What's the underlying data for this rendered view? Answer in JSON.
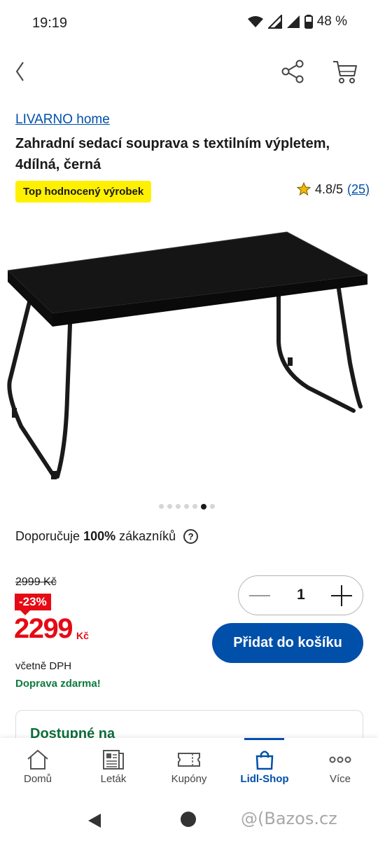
{
  "status_bar": {
    "time": "19:19",
    "battery": "48 %"
  },
  "header": {
    "back_icon": "chevron-left-icon",
    "share_icon": "share-icon",
    "cart_icon": "cart-icon"
  },
  "product": {
    "brand": "LIVARNO home",
    "title": "Zahradní sedací souprava s textilním výpletem, 4dílná, černá",
    "badge": "Top hodnocený výrobek",
    "rating": "4.8/5",
    "rating_count": "(25)",
    "image_count": 7,
    "active_image_index": 5
  },
  "recommend": {
    "prefix": "Doporučuje",
    "percent": "100%",
    "suffix": "zákazníků",
    "help_icon": "?"
  },
  "pricing": {
    "old_price": "2999 Kč",
    "discount": "-23%",
    "price": "2299",
    "currency": "Kč",
    "vat_note": "včetně DPH",
    "shipping": "Doprava zdarma!"
  },
  "cart": {
    "quantity": "1",
    "add_label": "Přidat do košíku"
  },
  "availability": {
    "title": "Dostupné na"
  },
  "bottom_nav": {
    "items": [
      {
        "label": "Domů",
        "icon": "home-icon"
      },
      {
        "label": "Leták",
        "icon": "flyer-icon"
      },
      {
        "label": "Kupóny",
        "icon": "coupon-icon"
      },
      {
        "label": "Lidl-Shop",
        "icon": "shopping-bag-icon",
        "active": true
      },
      {
        "label": "Více",
        "icon": "more-icon"
      }
    ]
  },
  "watermark": "@(Bazos.cz",
  "colors": {
    "brand_blue": "#0050aa",
    "sale_red": "#e60a14",
    "badge_yellow": "#fff000",
    "green": "#0d7a3e"
  }
}
